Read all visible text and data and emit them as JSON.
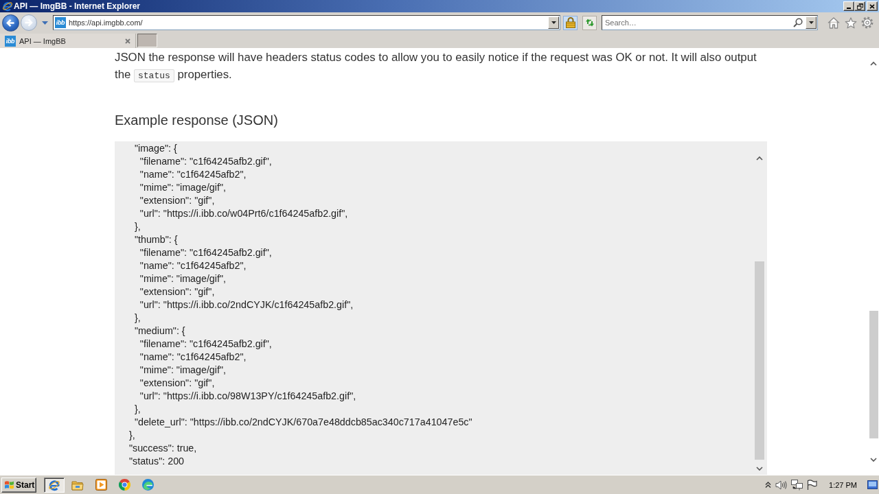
{
  "window": {
    "title": "API — ImgBB - Internet Explorer"
  },
  "navigation": {
    "back": {
      "disabled": false
    },
    "forward": {
      "disabled": true
    }
  },
  "address_bar": {
    "site_icon": "ibb",
    "url": "https://api.imgbb.com/"
  },
  "search": {
    "placeholder": "Search…"
  },
  "tabs": [
    {
      "site_icon": "ibb",
      "label": "API — ImgBB",
      "selected": true
    }
  ],
  "page": {
    "paragraph": {
      "segments": [
        {
          "kind": "text",
          "text": "JSON the response will have headers status codes to allow you to easily notice if the request was OK or not. It will also output the "
        },
        {
          "kind": "code",
          "text": "status"
        },
        {
          "kind": "text",
          "text": " properties."
        }
      ]
    },
    "heading": "Example response (JSON)",
    "code_lines": [
      "    \"image\": {",
      "      \"filename\": \"c1f64245afb2.gif\",",
      "      \"name\": \"c1f64245afb2\",",
      "      \"mime\": \"image/gif\",",
      "      \"extension\": \"gif\",",
      "      \"url\": \"https://i.ibb.co/w04Prt6/c1f64245afb2.gif\",",
      "    },",
      "    \"thumb\": {",
      "      \"filename\": \"c1f64245afb2.gif\",",
      "      \"name\": \"c1f64245afb2\",",
      "      \"mime\": \"image/gif\",",
      "      \"extension\": \"gif\",",
      "      \"url\": \"https://i.ibb.co/2ndCYJK/c1f64245afb2.gif\",",
      "    },",
      "    \"medium\": {",
      "      \"filename\": \"c1f64245afb2.gif\",",
      "      \"name\": \"c1f64245afb2\",",
      "      \"mime\": \"image/gif\",",
      "      \"extension\": \"gif\",",
      "      \"url\": \"https://i.ibb.co/98W13PY/c1f64245afb2.gif\",",
      "    },",
      "    \"delete_url\": \"https://ibb.co/2ndCYJK/670a7e48ddcb85ac340c717a41047e5c\"",
      "  },",
      "  \"success\": true,",
      "  \"status\": 200"
    ]
  },
  "taskbar": {
    "start": "Start",
    "apps": [
      {
        "selected": true
      },
      {
        "selected": false
      },
      {
        "selected": false
      },
      {
        "selected": false
      },
      {
        "selected": false
      }
    ],
    "clock": "1:27 PM"
  }
}
